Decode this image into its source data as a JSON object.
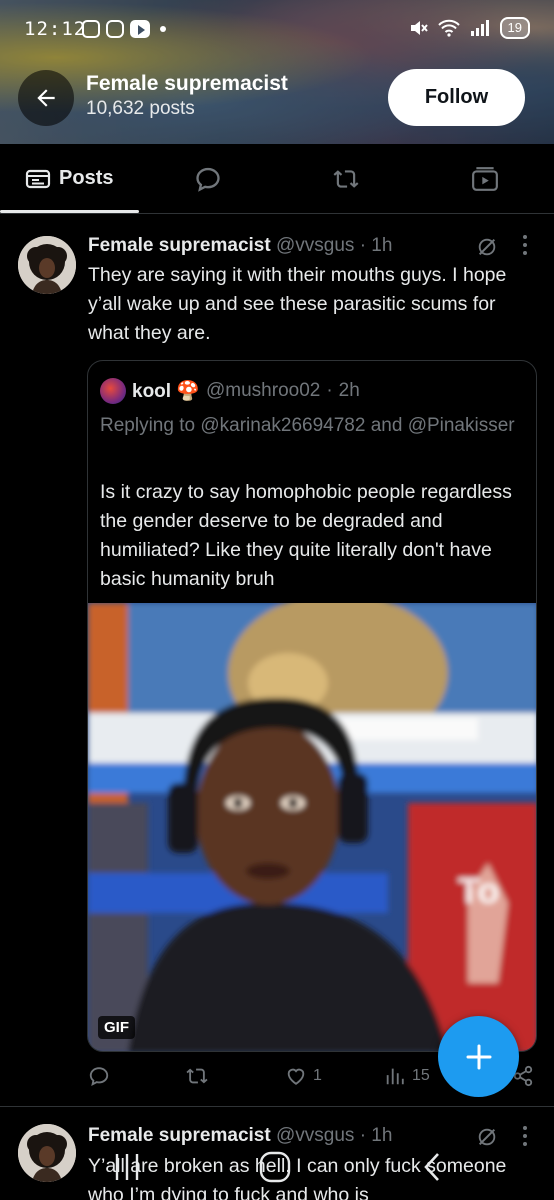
{
  "status_bar": {
    "time": "12:12",
    "battery": "19"
  },
  "profile": {
    "name": "Female supremacist",
    "posts": "10,632 posts",
    "follow_label": "Follow"
  },
  "tabs": [
    {
      "label": "Posts",
      "icon": "posts-icon"
    },
    {
      "label": "",
      "icon": "replies-icon"
    },
    {
      "label": "",
      "icon": "reposts-icon"
    },
    {
      "label": "",
      "icon": "media-icon"
    }
  ],
  "post1": {
    "name": "Female supremacist",
    "handle": "@vvsgus",
    "time": "1h",
    "text": "They are saying it with their mouths guys. I hope y’all wake up and see these parasitic scums for what they are.",
    "quote": {
      "name": "kool 🍄",
      "handle": "@mushroo02",
      "time": "2h",
      "replying_prefix": "Replying to",
      "replying_to1": "@karinak26694782",
      "replying_and": "and",
      "replying_to2": "@Pinakisser",
      "text": "Is it crazy to say homophobic people regardless the gender deserve to be degraded and humiliated? Like they quite literally don't have basic humanity bruh",
      "media_badge": "GIF"
    },
    "actions": {
      "replies": "",
      "reposts": "",
      "likes": "1",
      "views": "15"
    }
  },
  "post2": {
    "name": "Female supremacist",
    "handle": "@vvsgus",
    "time": "1h",
    "text": "Y’all are broken as hell. I can only fuck someone who I’m dying to fuck and who is"
  },
  "colors": {
    "background": "#000000",
    "text": "#e7e9ea",
    "muted": "#71767b",
    "accent": "#1d9bf0",
    "border": "#2f3336"
  }
}
